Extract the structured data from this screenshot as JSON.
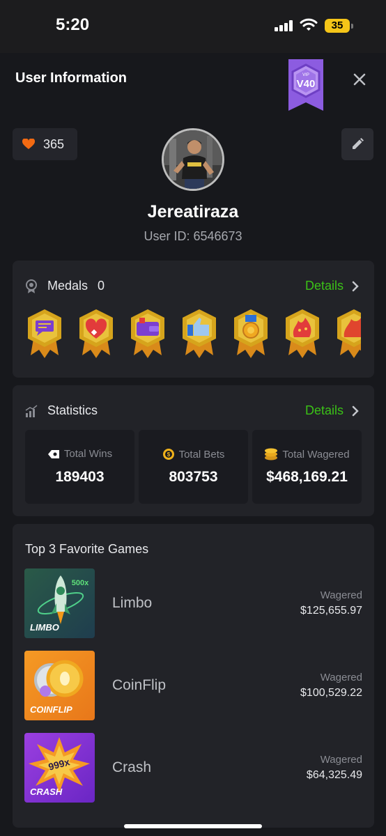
{
  "status_bar": {
    "time": "5:20",
    "battery": "35"
  },
  "header": {
    "title": "User Information",
    "vip_level": "V40",
    "vip_tag": "VIP"
  },
  "profile": {
    "likes": "365",
    "username": "Jereatiraza",
    "user_id": "User ID: 6546673"
  },
  "medals": {
    "label": "Medals",
    "count": "0",
    "details": "Details"
  },
  "statistics": {
    "label": "Statistics",
    "details": "Details",
    "items": [
      {
        "label": "Total Wins",
        "value": "189403"
      },
      {
        "label": "Total Bets",
        "value": "803753"
      },
      {
        "label": "Total Wagered",
        "value": "$468,169.21"
      }
    ]
  },
  "favorites": {
    "title": "Top 3 Favorite Games",
    "games": [
      {
        "name": "Limbo",
        "thumb_label": "LIMBO",
        "thumb_badge": "500x",
        "wagered_label": "Wagered",
        "wagered": "$125,655.97"
      },
      {
        "name": "CoinFlip",
        "thumb_label": "COINFLIP",
        "wagered_label": "Wagered",
        "wagered": "$100,529.22"
      },
      {
        "name": "Crash",
        "thumb_label": "CRASH",
        "thumb_badge": "999x",
        "wagered_label": "Wagered",
        "wagered": "$64,325.49"
      }
    ]
  },
  "colors": {
    "accent_green": "#3bc117",
    "heart": "#f36a12",
    "vip_purple": "#8c5ce0"
  }
}
